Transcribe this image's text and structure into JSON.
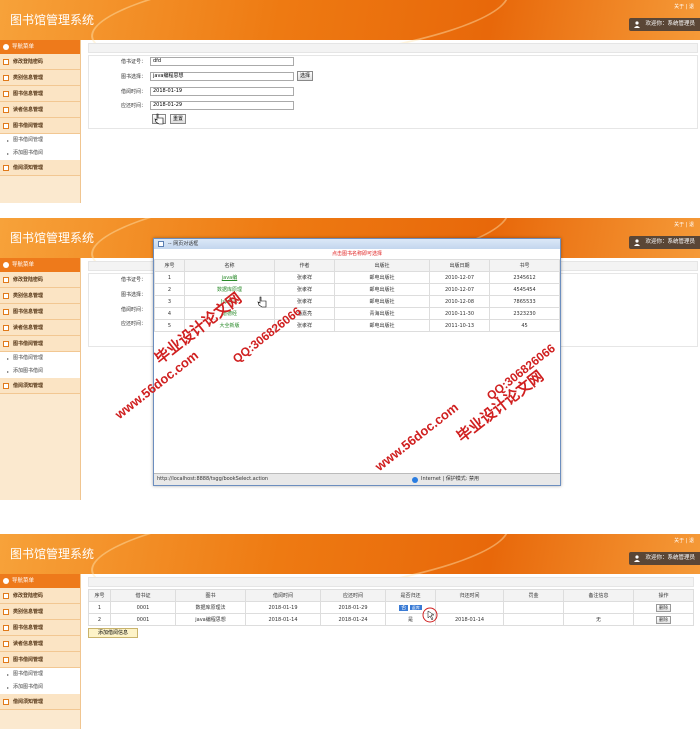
{
  "app": {
    "title": "图书馆管理系统",
    "header_links": "关于 | 退出",
    "header_links_short": "关于 | 退",
    "welcome": "欢迎你：系统管理员"
  },
  "sidebar": {
    "nav_title": "导航菜单",
    "items": [
      {
        "label": "修改登陆密码"
      },
      {
        "label": "类别信息管理"
      },
      {
        "label": "图书信息管理"
      },
      {
        "label": "读者信息管理"
      },
      {
        "label": "图书借阅管理"
      }
    ],
    "sub_items": [
      {
        "label": "图书借阅管理"
      },
      {
        "label": "添加图书借阅"
      }
    ],
    "last_item": {
      "label": "借阅须知管理"
    }
  },
  "form": {
    "card_label": "借书证号：",
    "card_value": "dfd",
    "book_label": "图书选择：",
    "book_value": "java编程思想",
    "select_button": "选择",
    "borrow_label": "借阅时间：",
    "borrow_value": "2018-01-19",
    "return_label": "应还时间：",
    "return_value": "2018-01-29",
    "reset_button": "重置"
  },
  "dialog": {
    "title": "-- 网页对话框",
    "hint": "点击图书名称即可选择",
    "columns": [
      "序号",
      "名称",
      "作者",
      "出版社",
      "出版日期",
      "书号"
    ],
    "rows": [
      {
        "no": "1",
        "name": "java编",
        "author": "张孝祥",
        "publisher": "邮电出版社",
        "date": "2010-12-07",
        "isbn": "2345612"
      },
      {
        "no": "2",
        "name": "数据库原理",
        "author": "张孝祥",
        "publisher": "邮电出版社",
        "date": "2010-12-07",
        "isbn": "4545454"
      },
      {
        "no": "3",
        "name": "Jsp技术",
        "author": "张孝祥",
        "publisher": "邮电出版社",
        "date": "2010-12-08",
        "isbn": "7865533"
      },
      {
        "no": "4",
        "name": "道德经",
        "author": "潘嘉亮",
        "publisher": "青海出版社",
        "date": "2010-11-30",
        "isbn": "2323230"
      },
      {
        "no": "5",
        "name": "大全新版",
        "author": "张孝祥",
        "publisher": "邮电出版社",
        "date": "2011-10-13",
        "isbn": "45"
      }
    ],
    "status_url": "http://localhost:8888/tsgg/bookSelect.action",
    "status_zone": "Internet | 保护模式: 禁用"
  },
  "borrow_list": {
    "columns": [
      "序号",
      "借书证",
      "图书",
      "借阅时间",
      "应还时间",
      "是否归还",
      "归还时间",
      "罚金",
      "备注信息",
      "操作"
    ],
    "rows": [
      {
        "no": "1",
        "card": "0001",
        "book": "数据库原理法",
        "borrow": "2018-01-19",
        "due": "2018-01-29",
        "returned": "否",
        "returned_btn": "返库",
        "return_time": "",
        "fine": "",
        "note": "",
        "op": "删除"
      },
      {
        "no": "2",
        "card": "0001",
        "book": "java编程思想",
        "borrow": "2018-01-14",
        "due": "2018-01-24",
        "returned": "是",
        "returned_btn": "",
        "return_time": "2018-01-14",
        "fine": "",
        "note": "无",
        "op": "删除"
      }
    ],
    "add_button": "添加借阅信息"
  },
  "watermarks": {
    "text1": "毕业设计论文网",
    "text2": "www.56doc.com",
    "text3": "QQ:306826066",
    "color": "#d02020"
  },
  "colors": {
    "accent": "#ee7a1b",
    "sidebar_bg": "#fbe9cf"
  }
}
